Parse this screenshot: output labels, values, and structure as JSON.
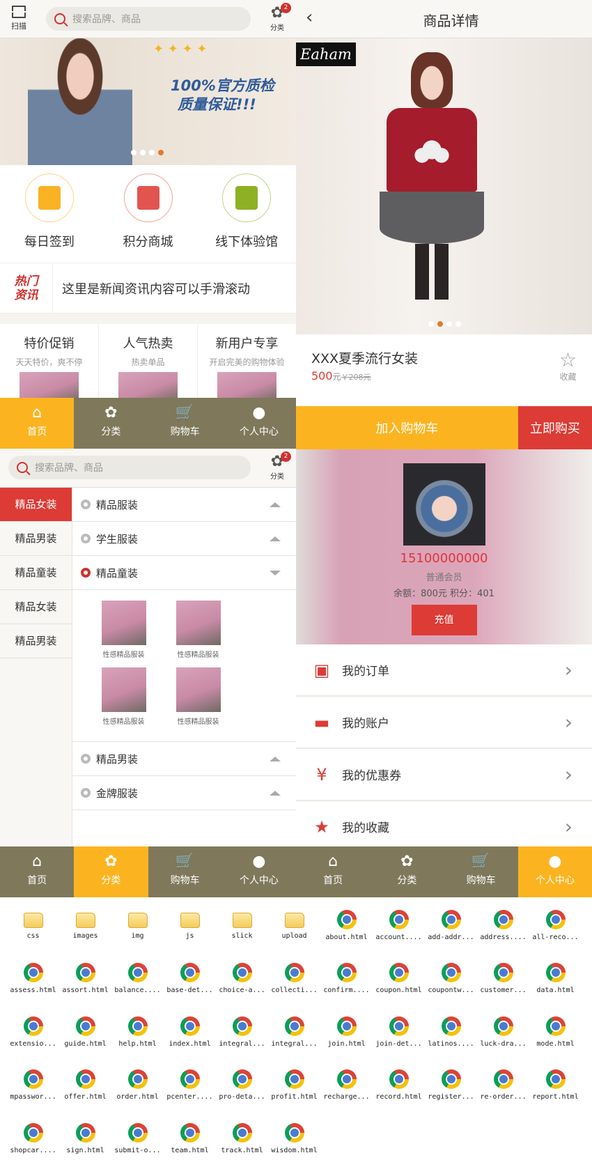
{
  "home": {
    "scan_label": "扫描",
    "search_placeholder": "搜索品牌、商品",
    "category_label": "分类",
    "category_badge": "2",
    "banner": {
      "line1": "100%官方质检",
      "line2": "质量保证!!!",
      "slides": 4,
      "active_slide": 4
    },
    "quick": [
      {
        "label": "每日签到",
        "icon": "calendar-icon",
        "color": "#f9b224"
      },
      {
        "label": "积分商城",
        "icon": "gift-icon",
        "color": "#e25450"
      },
      {
        "label": "线下体验馆",
        "icon": "store-icon",
        "color": "#8db123"
      }
    ],
    "news": {
      "tag_line1": "热门",
      "tag_line2": "资讯",
      "text": "这里是新闻资讯内容可以手滑滚动"
    },
    "promos": [
      {
        "title": "特价促销",
        "subtitle": "天天特价，爽不停"
      },
      {
        "title": "人气热卖",
        "subtitle": "热卖单品"
      },
      {
        "title": "新用户专享",
        "subtitle": "开启完美的购物体验"
      }
    ]
  },
  "nav_items": [
    "首页",
    "分类",
    "购物车",
    "个人中心"
  ],
  "category_page": {
    "search_placeholder": "搜索品牌、商品",
    "category_label": "分类",
    "category_badge": "2",
    "left_items": [
      "精品女装",
      "精品男装",
      "精品童装",
      "精品女装",
      "精品男装"
    ],
    "active_left": 0,
    "sections_top": [
      {
        "label": "精品服装",
        "expanded": false
      },
      {
        "label": "学生服装",
        "expanded": false
      },
      {
        "label": "精品童装",
        "expanded": true
      }
    ],
    "products": [
      "性感精品服装",
      "性感精品服装",
      "性感精品服装",
      "性感精品服装"
    ],
    "sections_bottom": [
      {
        "label": "精品男装",
        "expanded": false
      },
      {
        "label": "金牌服装",
        "expanded": false
      }
    ]
  },
  "detail": {
    "back_icon": "chevron-left-icon",
    "title": "商品详情",
    "brand": "Eaham",
    "slides": 4,
    "active_slide": 2,
    "product_name": "XXX夏季流行女装",
    "price": "500",
    "price_unit": "元",
    "original_price": "￥208元",
    "favorite_label": "收藏",
    "add_to_cart": "加入购物车",
    "buy_now": "立即购买"
  },
  "profile": {
    "phone": "15100000000",
    "level": "普通会员",
    "balance_text": "余额：800元 积分：401",
    "recharge": "充值",
    "menu": [
      {
        "label": "我的订单",
        "icon": "order-icon"
      },
      {
        "label": "我的账户",
        "icon": "account-card-icon"
      },
      {
        "label": "我的优惠券",
        "icon": "coupon-icon"
      },
      {
        "label": "我的收藏",
        "icon": "star-icon"
      }
    ]
  },
  "files": [
    {
      "name": "css",
      "type": "folder"
    },
    {
      "name": "images",
      "type": "folder"
    },
    {
      "name": "img",
      "type": "folder"
    },
    {
      "name": "js",
      "type": "folder"
    },
    {
      "name": "slick",
      "type": "folder"
    },
    {
      "name": "upload",
      "type": "folder"
    },
    {
      "name": "about.html",
      "type": "html"
    },
    {
      "name": "account....",
      "type": "html"
    },
    {
      "name": "add-addr...",
      "type": "html"
    },
    {
      "name": "address....",
      "type": "html"
    },
    {
      "name": "all-reco...",
      "type": "html"
    },
    {
      "name": "assess.html",
      "type": "html"
    },
    {
      "name": "assort.html",
      "type": "html"
    },
    {
      "name": "balance....",
      "type": "html"
    },
    {
      "name": "base-det...",
      "type": "html"
    },
    {
      "name": "choice-a...",
      "type": "html"
    },
    {
      "name": "collecti...",
      "type": "html"
    },
    {
      "name": "confirm....",
      "type": "html"
    },
    {
      "name": "coupon.html",
      "type": "html"
    },
    {
      "name": "coupontw...",
      "type": "html"
    },
    {
      "name": "customer...",
      "type": "html"
    },
    {
      "name": "data.html",
      "type": "html"
    },
    {
      "name": "extensio...",
      "type": "html"
    },
    {
      "name": "guide.html",
      "type": "html"
    },
    {
      "name": "help.html",
      "type": "html"
    },
    {
      "name": "index.html",
      "type": "html"
    },
    {
      "name": "integral...",
      "type": "html"
    },
    {
      "name": "integral...",
      "type": "html"
    },
    {
      "name": "join.html",
      "type": "html"
    },
    {
      "name": "join-det...",
      "type": "html"
    },
    {
      "name": "latinos....",
      "type": "html"
    },
    {
      "name": "luck-dra...",
      "type": "html"
    },
    {
      "name": "mode.html",
      "type": "html"
    },
    {
      "name": "mpasswor...",
      "type": "html"
    },
    {
      "name": "offer.html",
      "type": "html"
    },
    {
      "name": "order.html",
      "type": "html"
    },
    {
      "name": "pcenter....",
      "type": "html"
    },
    {
      "name": "pro-deta...",
      "type": "html"
    },
    {
      "name": "profit.html",
      "type": "html"
    },
    {
      "name": "recharge...",
      "type": "html"
    },
    {
      "name": "record.html",
      "type": "html"
    },
    {
      "name": "register...",
      "type": "html"
    },
    {
      "name": "re-order...",
      "type": "html"
    },
    {
      "name": "report.html",
      "type": "html"
    },
    {
      "name": "shopcar....",
      "type": "html"
    },
    {
      "name": "sign.html",
      "type": "html"
    },
    {
      "name": "submit-o...",
      "type": "html"
    },
    {
      "name": "team.html",
      "type": "html"
    },
    {
      "name": "track.html",
      "type": "html"
    },
    {
      "name": "wisdom.html",
      "type": "html"
    }
  ]
}
